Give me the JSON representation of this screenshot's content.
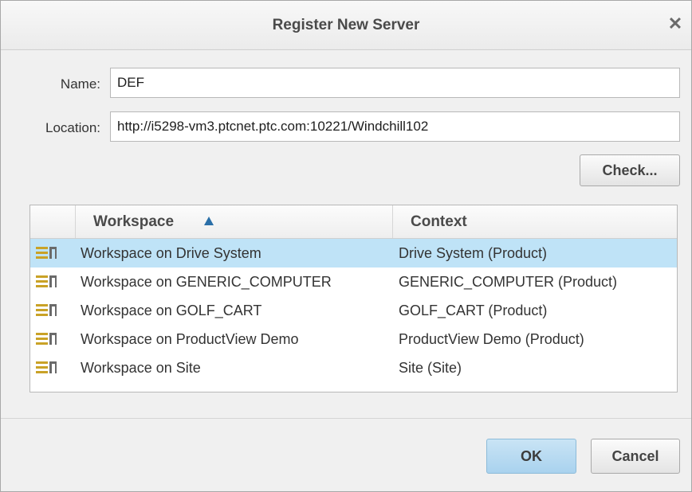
{
  "dialog": {
    "title": "Register New Server",
    "close_glyph": "✕"
  },
  "form": {
    "name_label": "Name:",
    "name_value": "DEF",
    "location_label": "Location:",
    "location_value": "http://i5298-vm3.ptcnet.ptc.com:10221/Windchill102",
    "check_label": "Check..."
  },
  "table": {
    "columns": [
      {
        "label": "Workspace",
        "sorted": "ascending"
      },
      {
        "label": "Context"
      }
    ],
    "rows": [
      {
        "workspace": "Workspace on Drive System",
        "context": "Drive System (Product)",
        "selected": true
      },
      {
        "workspace": "Workspace on GENERIC_COMPUTER",
        "context": "GENERIC_COMPUTER (Product)",
        "selected": false
      },
      {
        "workspace": "Workspace on GOLF_CART",
        "context": "GOLF_CART (Product)",
        "selected": false
      },
      {
        "workspace": "Workspace on ProductView Demo",
        "context": "ProductView Demo (Product)",
        "selected": false
      },
      {
        "workspace": "Workspace on Site",
        "context": "Site (Site)",
        "selected": false
      }
    ],
    "row_icon": "workspace-icon"
  },
  "footer": {
    "ok_label": "OK",
    "cancel_label": "Cancel"
  },
  "colors": {
    "selection": "#bfe3f7",
    "primary_button": "#b8dcf2",
    "sort_arrow": "#2a6fa8",
    "workspace_icon": "#c9a227"
  }
}
